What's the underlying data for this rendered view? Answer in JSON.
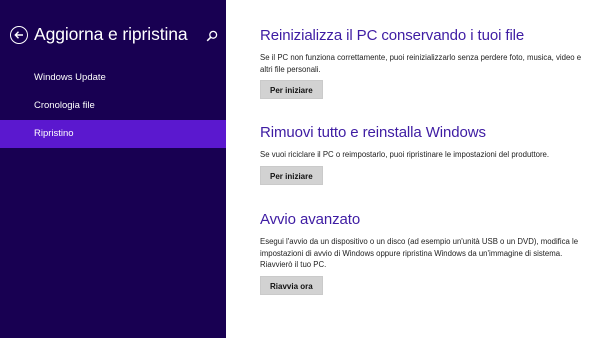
{
  "sidebar": {
    "title": "Aggiorna e ripristina",
    "back_icon": "back-arrow-circle-icon",
    "search_icon": "search-icon",
    "items": [
      {
        "label": "Windows Update",
        "active": false
      },
      {
        "label": "Cronologia file",
        "active": false
      },
      {
        "label": "Ripristino",
        "active": true
      }
    ]
  },
  "main": {
    "sections": [
      {
        "title": "Reinizializza il PC conservando i tuoi file",
        "description": "Se il PC non funziona correttamente, puoi reinizializzarlo senza perdere foto, musica, video e altri file personali.",
        "button": "Per iniziare"
      },
      {
        "title": "Rimuovi tutto e reinstalla Windows",
        "description": "Se vuoi riciclare il PC o reimpostarlo, puoi ripristinare le impostazioni del produttore.",
        "button": "Per iniziare"
      },
      {
        "title": "Avvio avanzato",
        "description": "Esegui l'avvio da un dispositivo o un disco (ad esempio un'unità USB o un DVD), modifica le impostazioni di avvio di Windows oppure ripristina Windows da un'immagine di sistema. Riavvierò il tuo PC.",
        "button": "Riavvia ora"
      }
    ]
  },
  "colors": {
    "sidebar_bg": "#180052",
    "active_item_bg": "#5b18cf",
    "section_title": "#3e1ca3",
    "button_bg": "#d2d2d2"
  }
}
